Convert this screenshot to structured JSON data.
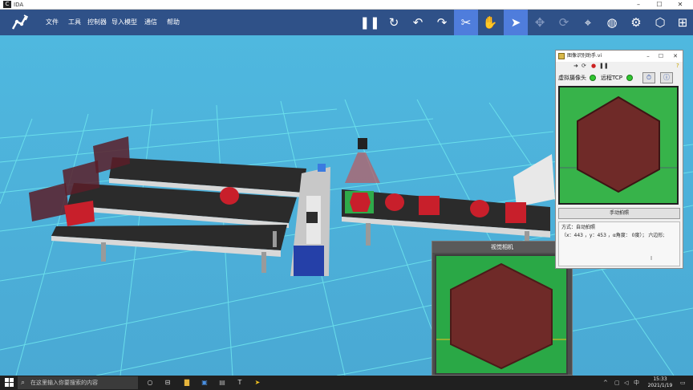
{
  "window": {
    "title": "IDA",
    "logo_text": "C"
  },
  "menu": {
    "items": [
      "文件",
      "工具",
      "控制器",
      "导入模型",
      "通信",
      "帮助"
    ]
  },
  "toolbar": {
    "icons": [
      "pause-icon",
      "refresh-icon",
      "undo-icon",
      "redo-icon",
      "robot-arm-icon",
      "hand-icon",
      "pointer-icon",
      "move-icon",
      "rotate-icon",
      "crosshair-icon",
      "globe-icon",
      "settings-icon",
      "cube-icon",
      "layout-icon"
    ]
  },
  "dialog": {
    "title": "图像识别助手.vi",
    "camera_label": "虚拟摄像头",
    "tcp_label": "远程TCP",
    "capture_button": "手动拍照",
    "result_line1": "方式：自动拍照",
    "result_line2": "（x：443 ，y：453 ，α角度： 0度）； 六边形;"
  },
  "vision_window": {
    "title": "视觉相机"
  },
  "taskbar": {
    "search_placeholder": "在这里输入你要搜索的内容",
    "time": "15:33",
    "date": "2021/1/19",
    "ime": "中"
  },
  "colors": {
    "toolbar_bg": "#2f5188",
    "active_tool": "#4f7ddc",
    "scene_sky": "#52c0e2",
    "grid_line": "#6fe6ee",
    "belt": "#2b2b2b",
    "block_red": "#c81f2b",
    "hexagon": "#6f2a28",
    "preview_green": "#37b34a"
  }
}
